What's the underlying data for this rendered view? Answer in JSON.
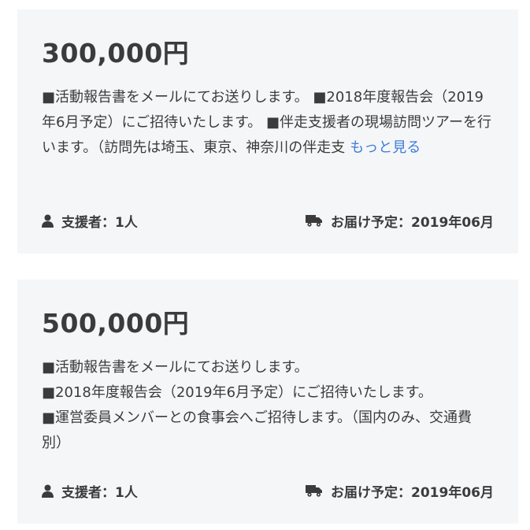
{
  "rewards": [
    {
      "price": "300,000円",
      "description": "■活動報告書をメールにてお送りします。 ■2018年度報告会（2019年6月予定）にご招待いたします。 ■伴走支援者の現場訪問ツアーを行います。（訪問先は埼玉、東京、神奈川の伴走支",
      "more_link": "もっと見る",
      "supporters": "支援者：1人",
      "delivery": "お届け予定：2019年06月"
    },
    {
      "price": "500,000円",
      "description_lines": [
        "■活動報告書をメールにてお送りします。",
        "■2018年度報告会（2019年6月予定）にご招待いたします。",
        "■運営委員メンバーとの食事会へご招待します。（国内のみ、交通費別）"
      ],
      "supporters": "支援者：1人",
      "delivery": "お届け予定：2019年06月"
    }
  ],
  "icons": {
    "supporter": "user-icon",
    "delivery": "truck-icon"
  },
  "colors": {
    "card_bg": "#f5f6f8",
    "text": "#3b3b3b",
    "link": "#3f7dd8"
  }
}
